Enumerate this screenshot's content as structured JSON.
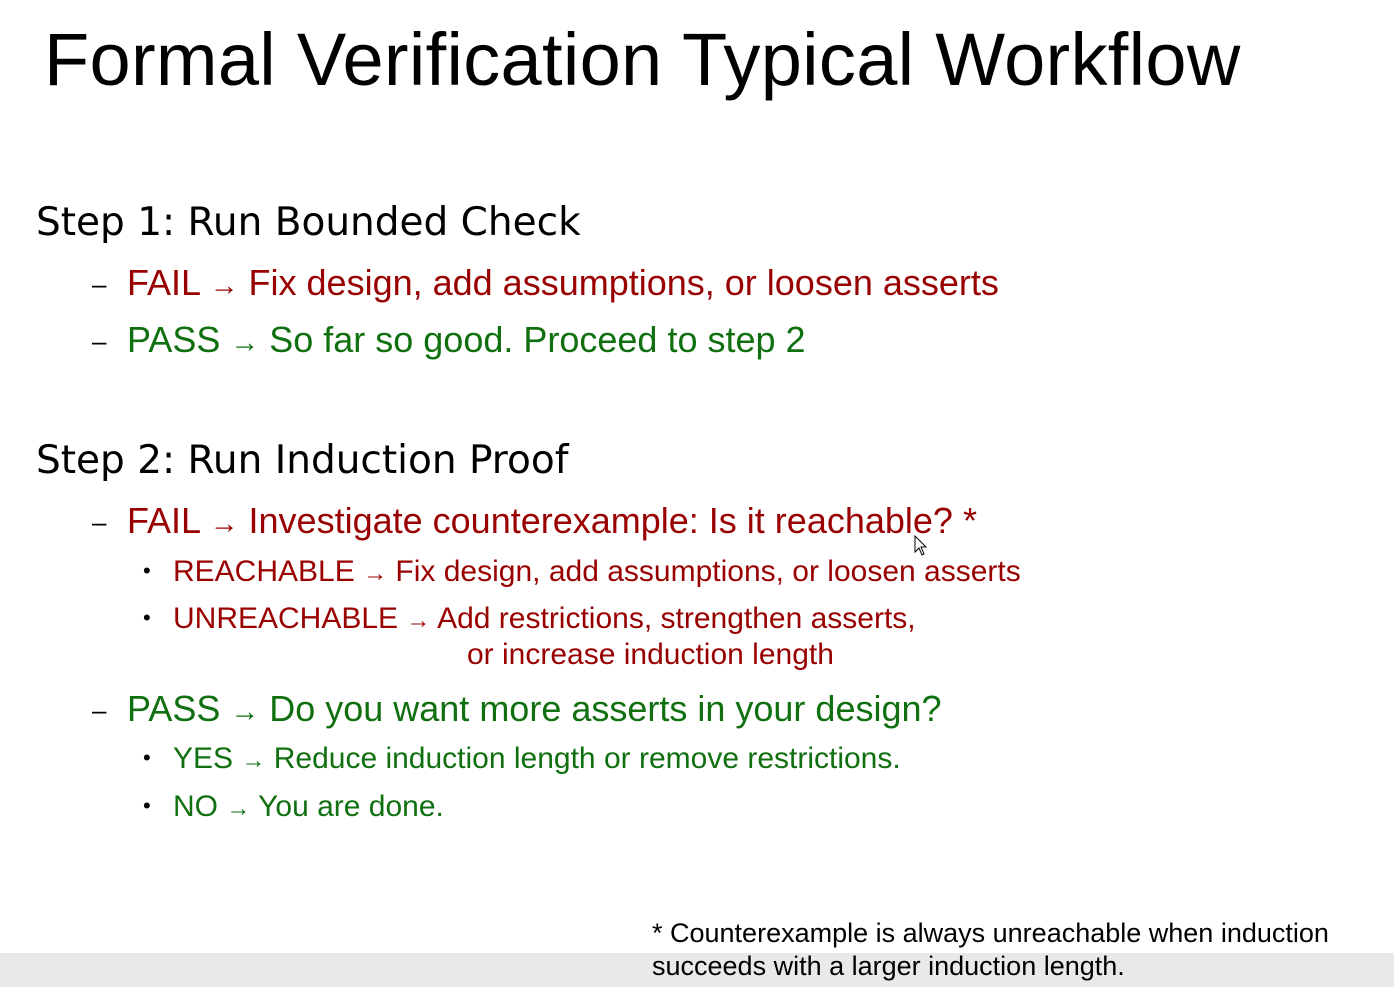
{
  "slide": {
    "title": "Formal Verification Typical Workflow",
    "step1": {
      "heading": "Step 1: Run Bounded Check",
      "fail": {
        "label": "FAIL",
        "text": "Fix design, add assumptions, or loosen asserts"
      },
      "pass": {
        "label": "PASS",
        "text": "So far so good. Proceed to step 2"
      }
    },
    "step2": {
      "heading": "Step 2: Run Induction Proof",
      "fail": {
        "label": "FAIL",
        "text": "Investigate counterexample: Is it reachable? *",
        "reachable": {
          "label": "REACHABLE",
          "text": "Fix design, add assumptions, or loosen asserts"
        },
        "unreachable": {
          "label": "UNREACHABLE",
          "text": "Add restrictions, strengthen asserts,",
          "text_cont": "or increase induction length"
        }
      },
      "pass": {
        "label": "PASS",
        "text": "Do you want more asserts in your design?",
        "yes": {
          "label": "YES",
          "text": "Reduce induction length or remove restrictions."
        },
        "no": {
          "label": "NO",
          "text": "You are done."
        }
      }
    },
    "arrow": "→",
    "dash": "–",
    "bullet": "•",
    "footnote": {
      "line1": "* Counterexample is always unreachable when induction",
      "line2": "succeeds with a larger induction length."
    }
  },
  "colors": {
    "fail": "#990000",
    "pass": "#107010",
    "text": "#000000",
    "bottom_bar": "#e9e9e9"
  },
  "icons": {
    "cursor": "mouse-pointer-icon"
  }
}
